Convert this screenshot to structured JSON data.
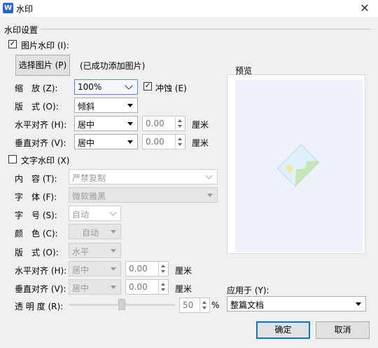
{
  "window": {
    "title": "水印",
    "app_icon": "W"
  },
  "section": {
    "label": "水印设置"
  },
  "picture_watermark": {
    "checkbox_label": "图片水印 (I):",
    "checked": true,
    "select_button": "选择图片 (P)",
    "status": "(已成功添加图片)",
    "scale_label": "缩　放 (Z):",
    "scale_value": "100%",
    "washout_label": "冲蚀 (E)",
    "washout_checked": true,
    "layout_label": "版　式 (O):",
    "layout_value": "倾斜",
    "h_align_label": "水平对齐 (H):",
    "h_align_value": "居中",
    "h_offset": "0.00",
    "v_align_label": "垂直对齐 (V):",
    "v_align_value": "居中",
    "v_offset": "0.00",
    "unit": "厘米"
  },
  "text_watermark": {
    "checkbox_label": "文字水印 (X)",
    "checked": false,
    "content_label": "内　容 (T):",
    "content_value": "严禁复制",
    "font_label": "字　体 (F):",
    "font_value": "微软雅黑",
    "size_label": "字　号 (S):",
    "size_value": "自动",
    "color_label": "颜　色 (C):",
    "color_value": "自动",
    "layout_label": "版　式 (O):",
    "layout_value": "水平",
    "h_align_label": "水平对齐 (H):",
    "h_align_value": "居中",
    "h_offset": "0.00",
    "v_align_label": "垂直对齐 (V):",
    "v_align_value": "居中",
    "v_offset": "0.00",
    "unit": "厘米",
    "transparency_label": "透 明 度 (R):",
    "transparency_value": "50",
    "transparency_unit": "%"
  },
  "preview": {
    "label": "预览"
  },
  "apply": {
    "label": "应用于 (Y):",
    "value": "整篇文档"
  },
  "buttons": {
    "ok": "确定",
    "cancel": "取消"
  },
  "colors": {
    "accent": "#0078d7",
    "icon_blue": "#2b66d8"
  }
}
